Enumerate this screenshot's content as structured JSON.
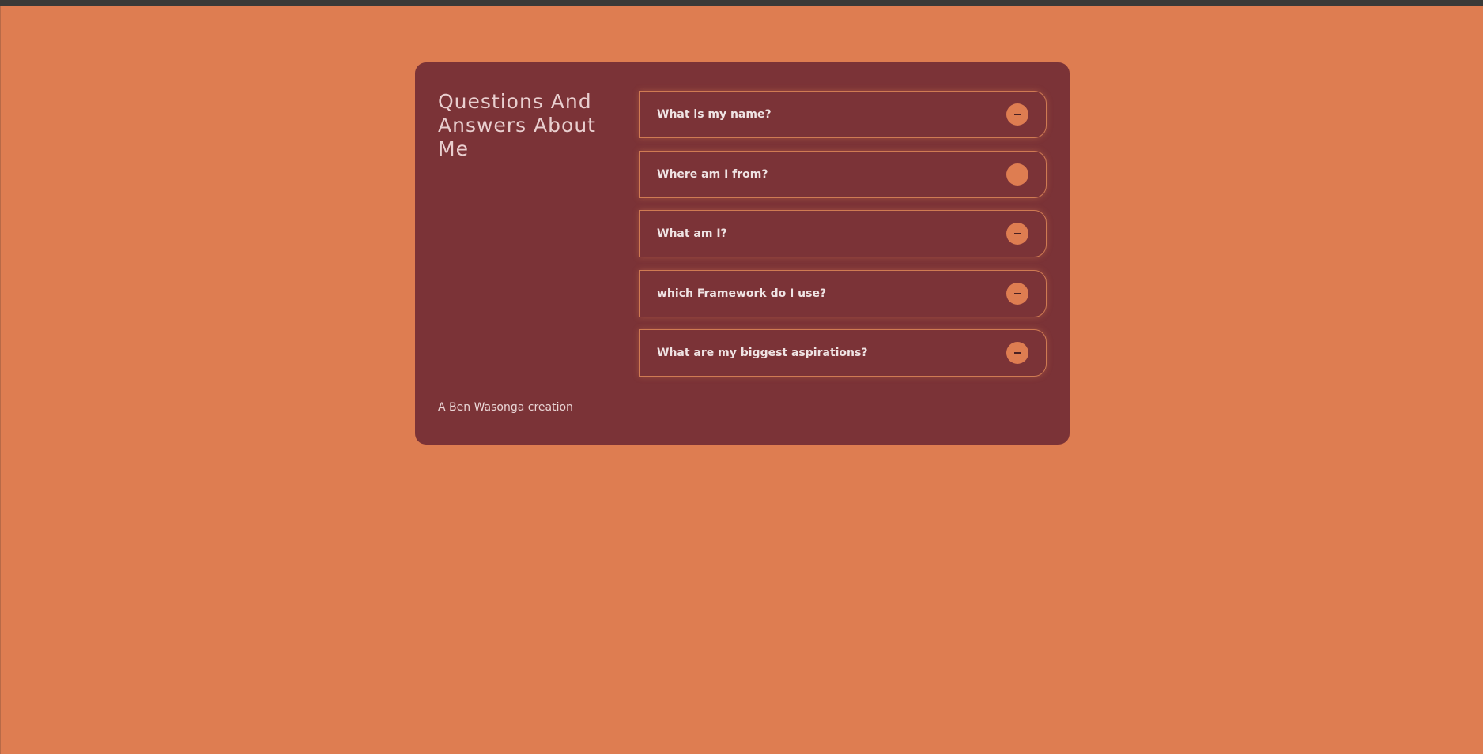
{
  "card": {
    "title": "Questions And Answers About Me",
    "footer": "A Ben Wasonga creation"
  },
  "questions": [
    {
      "label": "What is my name?",
      "toggle_icon": "minus-icon"
    },
    {
      "label": "Where am I from?",
      "toggle_icon": "minus-icon"
    },
    {
      "label": "What am I?",
      "toggle_icon": "minus-icon"
    },
    {
      "label": "which Framework do I use?",
      "toggle_icon": "minus-icon"
    },
    {
      "label": "What are my biggest aspirations?",
      "toggle_icon": "minus-icon"
    }
  ],
  "colors": {
    "background": "#de7d51",
    "card": "#7b3337",
    "accent": "#de7d51",
    "text": "#efe3e3"
  }
}
